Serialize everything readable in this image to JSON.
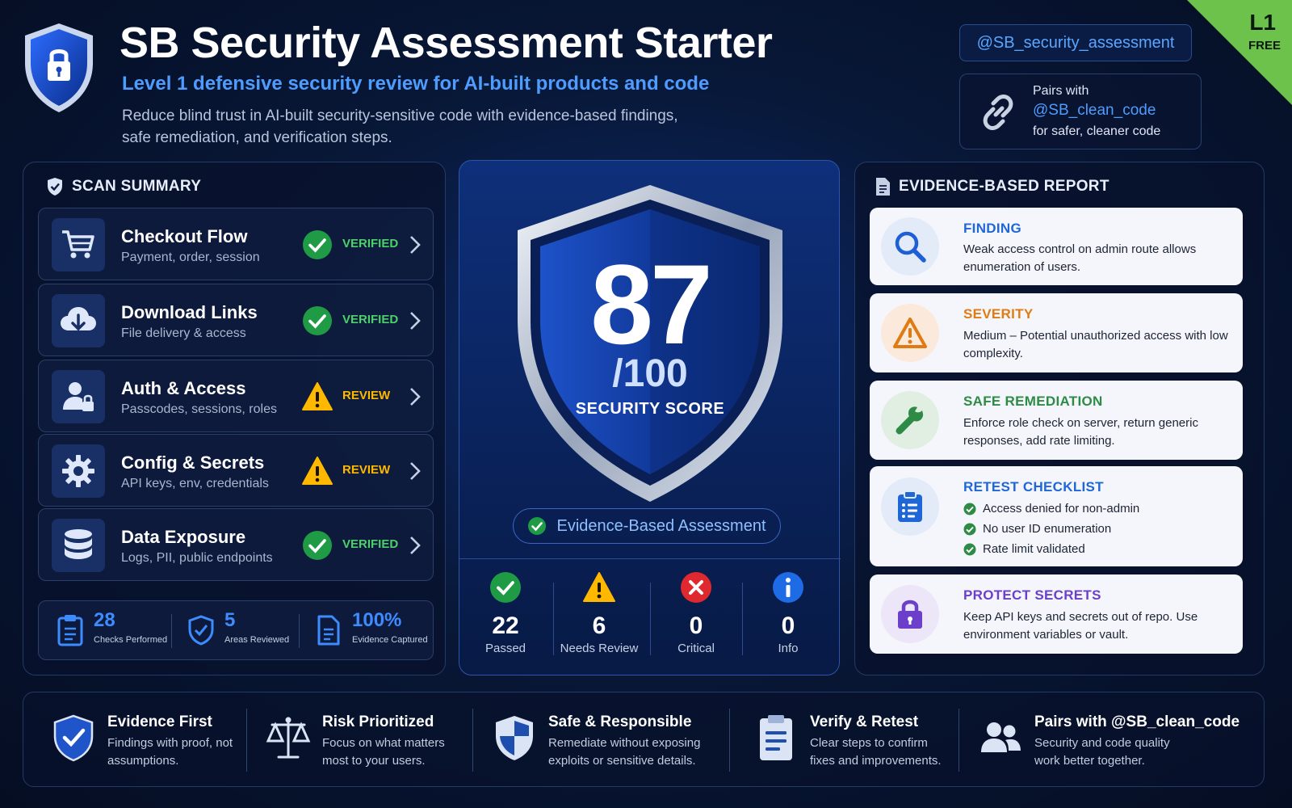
{
  "header": {
    "title": "SB Security Assessment Starter",
    "subtitle": "Level 1 defensive security review for AI-built products and code",
    "description": "Reduce blind trust in AI-built security-sensitive code with evidence-based findings, safe remediation, and verification steps.",
    "handle": "@SB_security_assessment",
    "pairs_with_label": "Pairs with",
    "pairs_with_handle": "@SB_clean_code",
    "pairs_with_note": "for safer, cleaner code",
    "level_badge": "L1",
    "level_badge_sub": "FREE"
  },
  "scan_summary": {
    "heading": "SCAN SUMMARY",
    "items": [
      {
        "title": "Checkout Flow",
        "subtitle": "Payment, order, session",
        "status": "VERIFIED",
        "icon": "cart-icon"
      },
      {
        "title": "Download Links",
        "subtitle": "File delivery & access",
        "status": "VERIFIED",
        "icon": "cloud-download-icon"
      },
      {
        "title": "Auth & Access",
        "subtitle": "Passcodes, sessions, roles",
        "status": "REVIEW",
        "icon": "user-lock-icon"
      },
      {
        "title": "Config & Secrets",
        "subtitle": "API keys, env, credentials",
        "status": "REVIEW",
        "icon": "gear-icon"
      },
      {
        "title": "Data Exposure",
        "subtitle": "Logs, PII, public endpoints",
        "status": "VERIFIED",
        "icon": "database-icon"
      }
    ],
    "stats": [
      {
        "value": "28",
        "label": "Checks Performed"
      },
      {
        "value": "5",
        "label": "Areas Reviewed"
      },
      {
        "value": "100%",
        "label": "Evidence Captured"
      }
    ]
  },
  "score": {
    "value": "87",
    "denominator": "/100",
    "label": "SECURITY SCORE",
    "pill": "Evidence-Based Assessment",
    "stats": [
      {
        "value": "22",
        "label": "Passed"
      },
      {
        "value": "6",
        "label": "Needs Review"
      },
      {
        "value": "0",
        "label": "Critical"
      },
      {
        "value": "0",
        "label": "Info"
      }
    ]
  },
  "report": {
    "heading": "EVIDENCE-BASED REPORT",
    "finding": {
      "title": "FINDING",
      "text": "Weak access control on admin route allows enumeration of users."
    },
    "severity": {
      "title": "SEVERITY",
      "text": "Medium – Potential unauthorized access with low complexity."
    },
    "remediation": {
      "title": "SAFE REMEDIATION",
      "text": "Enforce role check on server, return generic responses, add rate limiting."
    },
    "retest": {
      "title": "RETEST CHECKLIST",
      "items": [
        "Access denied for non-admin",
        "No user ID enumeration",
        "Rate limit validated"
      ]
    },
    "secrets": {
      "title": "PROTECT SECRETS",
      "text": "Keep API keys and secrets out of repo. Use environment variables or vault."
    }
  },
  "footer": [
    {
      "title": "Evidence First",
      "text": "Findings with proof, not assumptions."
    },
    {
      "title": "Risk Prioritized",
      "text": "Focus on what matters most to your users."
    },
    {
      "title": "Safe & Responsible",
      "text": "Remediate without exposing exploits or sensitive details."
    },
    {
      "title": "Verify & Retest",
      "text": "Clear steps to confirm fixes and improvements."
    },
    {
      "title": "Pairs with @SB_clean_code",
      "text": "Security and code quality work better together."
    }
  ],
  "colors": {
    "verified": "#4cd16a",
    "review": "#ffb800",
    "accent": "#4f9cff",
    "badge": "#6cc24a"
  }
}
